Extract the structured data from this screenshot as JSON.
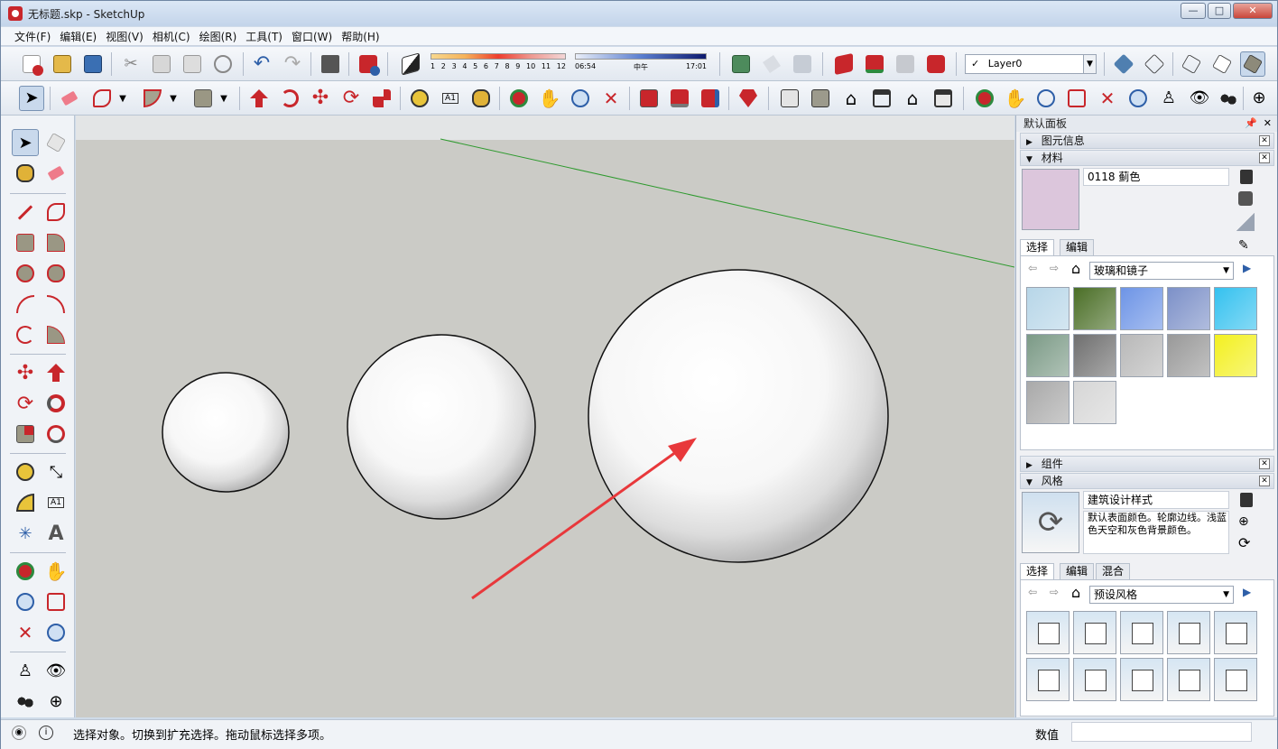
{
  "window": {
    "title": "无标题.skp - SketchUp",
    "min": "—",
    "max": "□",
    "close": "✕"
  },
  "menu": [
    "文件(F)",
    "编辑(E)",
    "视图(V)",
    "相机(C)",
    "绘图(R)",
    "工具(T)",
    "窗口(W)",
    "帮助(H)"
  ],
  "toolbar": {
    "shadow_months": [
      "1",
      "2",
      "3",
      "4",
      "5",
      "6",
      "7",
      "8",
      "9",
      "10",
      "11",
      "12"
    ],
    "time_start": "06:54",
    "time_mid": "中午",
    "time_end": "17:01",
    "layer_check": "✓",
    "layer_name": "Layer0"
  },
  "tray": {
    "title": "默认面板",
    "entity_info": "图元信息",
    "materials": {
      "heading": "材料",
      "material_name": "0118 蓟色",
      "swatch_color": "#dcc6dc",
      "tab_select": "选择",
      "tab_edit": "编辑",
      "library": "玻璃和镜子",
      "swatches": [
        "#b7d6e8",
        "#4a6e26",
        "#6d94e6",
        "#7c90c8",
        "#34c1ef",
        "#7b9a86",
        "#6f6f6f",
        "#b8b8b8",
        "#999999",
        "#f3f020",
        "#a9a9a9",
        "#d6d6d6"
      ]
    },
    "components": "组件",
    "styles": {
      "heading": "风格",
      "style_name": "建筑设计样式",
      "description": "默认表面颜色。轮廓边线。浅蓝色天空和灰色背景颜色。",
      "tab_select": "选择",
      "tab_edit": "编辑",
      "tab_mix": "混合",
      "library": "预设风格"
    }
  },
  "status": {
    "message": "选择对象。切换到扩充选择。拖动鼠标选择多项。",
    "measure_label": "数值",
    "measure_value": ""
  },
  "colors": {
    "accent": "#c8262b",
    "axis_green": "#2e9a2e",
    "arrow": "#e8383b"
  }
}
